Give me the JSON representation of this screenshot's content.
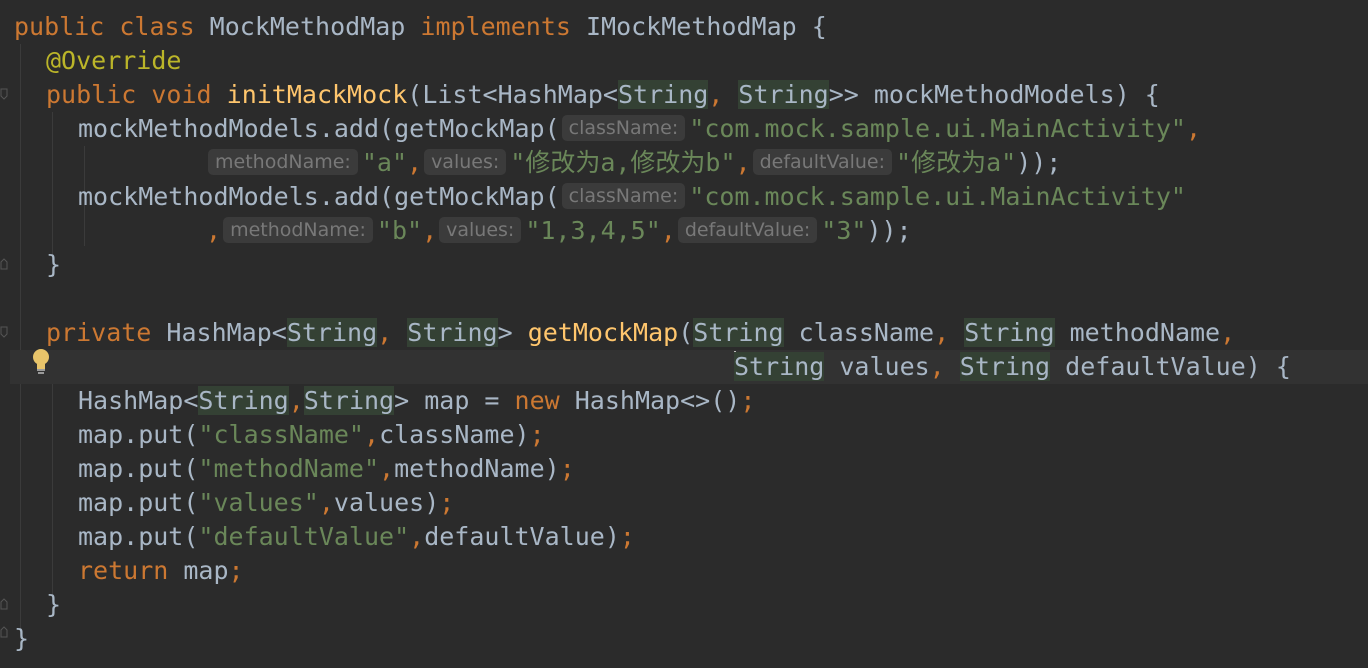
{
  "hints": {
    "className": "className:",
    "methodName": "methodName:",
    "values": "values:",
    "defaultValue": "defaultValue:"
  },
  "code": {
    "l1": {
      "kw": "public class",
      "name": " MockMethodMap ",
      "kw2": "implements",
      "iface": " IMockMethodMap {"
    },
    "l2": {
      "anno": "@Override"
    },
    "l3": {
      "kw": "public void",
      "fn": "initMackMock",
      "a": "(List<HashMap<",
      "t1": "String",
      "b": ", ",
      "t2": "String",
      "c": ">> mockMethodModels) {"
    },
    "l4": {
      "a": "mockMethodModels.add(getMockMap(",
      "s": "\"com.mock.sample.ui.MainActivity\"",
      "c": ","
    },
    "l5": {
      "s1": "\"a\"",
      "c1": ",",
      "s2": "\"修改为a,修改为b\"",
      "c2": ",",
      "s3": "\"修改为a\"",
      "end": "));"
    },
    "l6": {
      "a": "mockMethodModels.add(getMockMap(",
      "s": "\"com.mock.sample.ui.MainActivity\""
    },
    "l7": {
      "c0": ",",
      "s1": "\"b\"",
      "c1": ",",
      "s2": "\"1,3,4,5\"",
      "c2": ",",
      "s3": "\"3\"",
      "end": "));"
    },
    "l8": {
      "a": "}"
    },
    "l9": {
      "kw": "private",
      "a": " HashMap<",
      "t1": "String",
      "c1": ",",
      "b": " ",
      "t2": "String",
      "c": "> ",
      "fn": "getMockMap",
      "d": "(",
      "t3": "String",
      "e": " className",
      "c2": ",",
      "f": " ",
      "t4": "String",
      "g": " methodName",
      "c3": ","
    },
    "l10": {
      "t1": "String",
      "a": " values",
      "c1": ",",
      "b": " ",
      "t2": "String",
      "c": " defaultValue) {"
    },
    "l11": {
      "a": "HashMap<",
      "t1": "String",
      "c1": ",",
      "t2": "String",
      "b": "> map = ",
      "kw": "new",
      "c": " HashMap<>()",
      "end": ";"
    },
    "l12": {
      "a": "map.put(",
      "s": "\"className\"",
      "c1": ",",
      "b": "className)",
      "end": ";"
    },
    "l13": {
      "a": "map.put(",
      "s": "\"methodName\"",
      "c1": ",",
      "b": "methodName)",
      "end": ";"
    },
    "l14": {
      "a": "map.put(",
      "s": "\"values\"",
      "c1": ",",
      "b": "values)",
      "end": ";"
    },
    "l15": {
      "a": "map.put(",
      "s": "\"defaultValue\"",
      "c1": ",",
      "b": "defaultValue)",
      "end": ";"
    },
    "l16": {
      "kw": "return",
      "a": " map",
      "end": ";"
    },
    "l17": {
      "a": "}"
    },
    "l18": {
      "a": "}"
    }
  },
  "colors": {
    "background": "#2b2b2b",
    "keyword": "#cc7832",
    "annotation": "#bbb529",
    "method": "#ffc66d",
    "string": "#6a8759",
    "text": "#a9b7c6",
    "hint": "#787878"
  },
  "icons": [
    "fold-icon",
    "lightbulb-icon"
  ]
}
